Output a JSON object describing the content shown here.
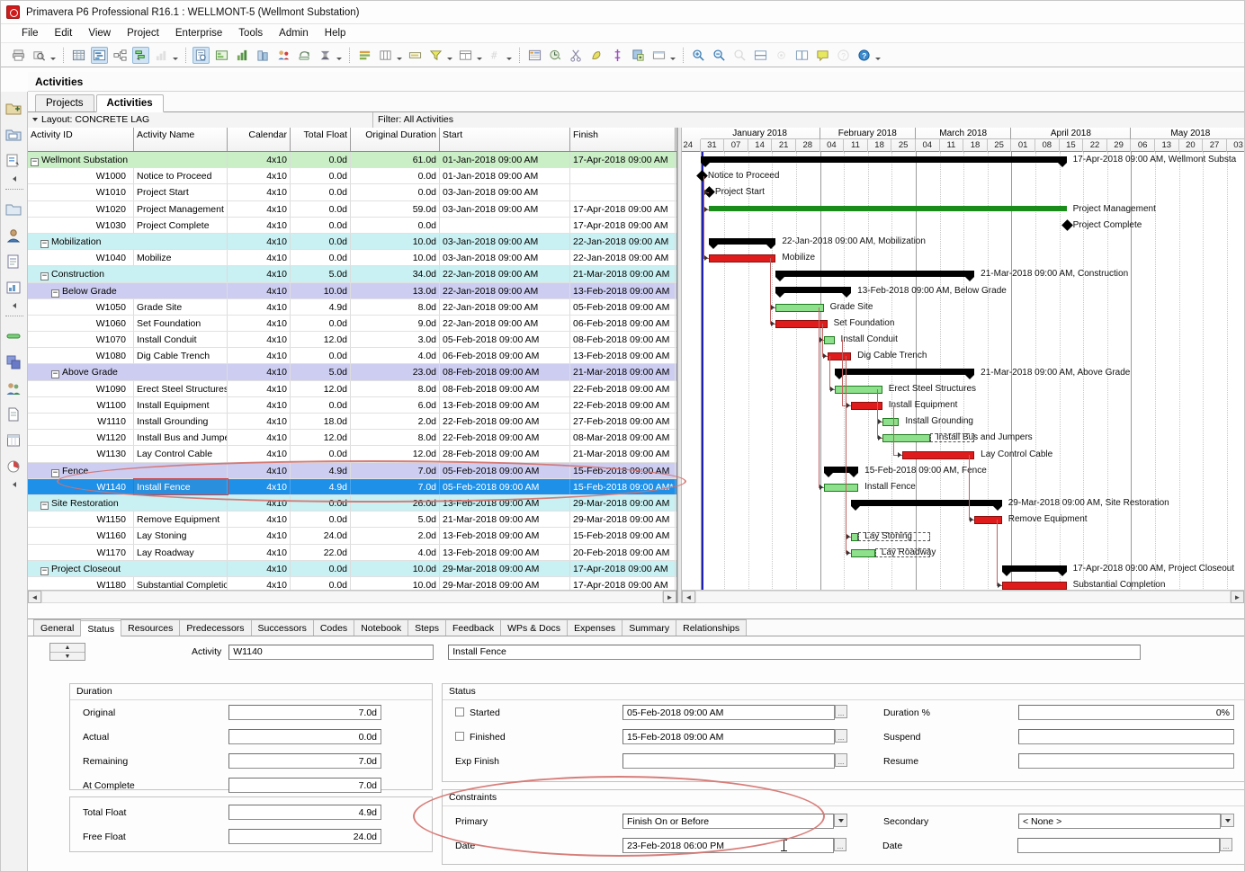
{
  "window": {
    "title": "Primavera P6 Professional R16.1 : WELLMONT-5 (Wellmont Substation)",
    "logo_color": "#cf1b1b"
  },
  "menu": [
    "File",
    "Edit",
    "View",
    "Project",
    "Enterprise",
    "Tools",
    "Admin",
    "Help"
  ],
  "workspace": {
    "title": "Activities",
    "tabs": [
      {
        "label": "Projects",
        "selected": false
      },
      {
        "label": "Activities",
        "selected": true
      }
    ]
  },
  "layout_bar": {
    "layout_label": "Layout: CONCRETE LAG",
    "filter_label": "Filter: All Activities"
  },
  "grid": {
    "columns": [
      "Activity ID",
      "Activity Name",
      "Calendar",
      "Total Float",
      "Original Duration",
      "Start",
      "Finish"
    ],
    "rows": [
      {
        "level": 0,
        "type": "wbs",
        "id": "Wellmont Substation",
        "name": "",
        "calendar": "4x10",
        "total_float": "0.0d",
        "original_duration": "61.0d",
        "start": "01-Jan-2018 09:00 AM",
        "finish": "17-Apr-2018 09:00 AM"
      },
      {
        "level": 0,
        "type": "task",
        "id": "W1000",
        "name": "Notice to Proceed",
        "calendar": "4x10",
        "total_float": "0.0d",
        "original_duration": "0.0d",
        "start": "01-Jan-2018 09:00 AM",
        "finish": ""
      },
      {
        "level": 0,
        "type": "task",
        "id": "W1010",
        "name": "Project Start",
        "calendar": "4x10",
        "total_float": "0.0d",
        "original_duration": "0.0d",
        "start": "03-Jan-2018 09:00 AM",
        "finish": ""
      },
      {
        "level": 0,
        "type": "task",
        "id": "W1020",
        "name": "Project Management",
        "calendar": "4x10",
        "total_float": "0.0d",
        "original_duration": "59.0d",
        "start": "03-Jan-2018 09:00 AM",
        "finish": "17-Apr-2018 09:00 AM"
      },
      {
        "level": 0,
        "type": "task",
        "id": "W1030",
        "name": "Project Complete",
        "calendar": "4x10",
        "total_float": "0.0d",
        "original_duration": "0.0d",
        "start": "",
        "finish": "17-Apr-2018 09:00 AM"
      },
      {
        "level": 1,
        "type": "wbs",
        "id": "Mobilization",
        "name": "",
        "calendar": "4x10",
        "total_float": "0.0d",
        "original_duration": "10.0d",
        "start": "03-Jan-2018 09:00 AM",
        "finish": "22-Jan-2018 09:00 AM"
      },
      {
        "level": 1,
        "type": "task",
        "id": "W1040",
        "name": "Mobilize",
        "calendar": "4x10",
        "total_float": "0.0d",
        "original_duration": "10.0d",
        "start": "03-Jan-2018 09:00 AM",
        "finish": "22-Jan-2018 09:00 AM"
      },
      {
        "level": 1,
        "type": "wbs",
        "id": "Construction",
        "name": "",
        "calendar": "4x10",
        "total_float": "5.0d",
        "original_duration": "34.0d",
        "start": "22-Jan-2018 09:00 AM",
        "finish": "21-Mar-2018 09:00 AM"
      },
      {
        "level": 2,
        "type": "wbs2",
        "id": "Below Grade",
        "name": "",
        "calendar": "4x10",
        "total_float": "10.0d",
        "original_duration": "13.0d",
        "start": "22-Jan-2018 09:00 AM",
        "finish": "13-Feb-2018 09:00 AM"
      },
      {
        "level": 2,
        "type": "task",
        "id": "W1050",
        "name": "Grade Site",
        "calendar": "4x10",
        "total_float": "4.9d",
        "original_duration": "8.0d",
        "start": "22-Jan-2018 09:00 AM",
        "finish": "05-Feb-2018 09:00 AM"
      },
      {
        "level": 2,
        "type": "task",
        "id": "W1060",
        "name": "Set Foundation",
        "calendar": "4x10",
        "total_float": "0.0d",
        "original_duration": "9.0d",
        "start": "22-Jan-2018 09:00 AM",
        "finish": "06-Feb-2018 09:00 AM"
      },
      {
        "level": 2,
        "type": "task",
        "id": "W1070",
        "name": "Install Conduit",
        "calendar": "4x10",
        "total_float": "12.0d",
        "original_duration": "3.0d",
        "start": "05-Feb-2018 09:00 AM",
        "finish": "08-Feb-2018 09:00 AM"
      },
      {
        "level": 2,
        "type": "task",
        "id": "W1080",
        "name": "Dig Cable Trench",
        "calendar": "4x10",
        "total_float": "0.0d",
        "original_duration": "4.0d",
        "start": "06-Feb-2018 09:00 AM",
        "finish": "13-Feb-2018 09:00 AM"
      },
      {
        "level": 2,
        "type": "wbs2",
        "id": "Above Grade",
        "name": "",
        "calendar": "4x10",
        "total_float": "5.0d",
        "original_duration": "23.0d",
        "start": "08-Feb-2018 09:00 AM",
        "finish": "21-Mar-2018 09:00 AM"
      },
      {
        "level": 2,
        "type": "task",
        "id": "W1090",
        "name": "Erect Steel Structures",
        "calendar": "4x10",
        "total_float": "12.0d",
        "original_duration": "8.0d",
        "start": "08-Feb-2018 09:00 AM",
        "finish": "22-Feb-2018 09:00 AM"
      },
      {
        "level": 2,
        "type": "task",
        "id": "W1100",
        "name": "Install Equipment",
        "calendar": "4x10",
        "total_float": "0.0d",
        "original_duration": "6.0d",
        "start": "13-Feb-2018 09:00 AM",
        "finish": "22-Feb-2018 09:00 AM"
      },
      {
        "level": 2,
        "type": "task",
        "id": "W1110",
        "name": "Install Grounding",
        "calendar": "4x10",
        "total_float": "18.0d",
        "original_duration": "2.0d",
        "start": "22-Feb-2018 09:00 AM",
        "finish": "27-Feb-2018 09:00 AM"
      },
      {
        "level": 2,
        "type": "task",
        "id": "W1120",
        "name": "Install Bus and Jumpers",
        "calendar": "4x10",
        "total_float": "12.0d",
        "original_duration": "8.0d",
        "start": "22-Feb-2018 09:00 AM",
        "finish": "08-Mar-2018 09:00 AM"
      },
      {
        "level": 2,
        "type": "task",
        "id": "W1130",
        "name": "Lay Control Cable",
        "calendar": "4x10",
        "total_float": "0.0d",
        "original_duration": "12.0d",
        "start": "28-Feb-2018 09:00 AM",
        "finish": "21-Mar-2018 09:00 AM"
      },
      {
        "level": 2,
        "type": "wbs2",
        "id": "Fence",
        "name": "",
        "calendar": "4x10",
        "total_float": "4.9d",
        "original_duration": "7.0d",
        "start": "05-Feb-2018 09:00 AM",
        "finish": "15-Feb-2018 09:00 AM"
      },
      {
        "level": 2,
        "type": "selected",
        "id": "W1140",
        "name": "Install Fence",
        "calendar": "4x10",
        "total_float": "4.9d",
        "original_duration": "7.0d",
        "start": "05-Feb-2018 09:00 AM",
        "finish": "15-Feb-2018 09:00 AM*"
      },
      {
        "level": 1,
        "type": "wbs",
        "id": "Site Restoration",
        "name": "",
        "calendar": "4x10",
        "total_float": "0.0d",
        "original_duration": "26.0d",
        "start": "13-Feb-2018 09:00 AM",
        "finish": "29-Mar-2018 09:00 AM"
      },
      {
        "level": 1,
        "type": "task",
        "id": "W1150",
        "name": "Remove Equipment",
        "calendar": "4x10",
        "total_float": "0.0d",
        "original_duration": "5.0d",
        "start": "21-Mar-2018 09:00 AM",
        "finish": "29-Mar-2018 09:00 AM"
      },
      {
        "level": 1,
        "type": "task",
        "id": "W1160",
        "name": "Lay Stoning",
        "calendar": "4x10",
        "total_float": "24.0d",
        "original_duration": "2.0d",
        "start": "13-Feb-2018 09:00 AM",
        "finish": "15-Feb-2018 09:00 AM"
      },
      {
        "level": 1,
        "type": "task",
        "id": "W1170",
        "name": "Lay Roadway",
        "calendar": "4x10",
        "total_float": "22.0d",
        "original_duration": "4.0d",
        "start": "13-Feb-2018 09:00 AM",
        "finish": "20-Feb-2018 09:00 AM"
      },
      {
        "level": 1,
        "type": "wbs",
        "id": "Project Closeout",
        "name": "",
        "calendar": "4x10",
        "total_float": "0.0d",
        "original_duration": "10.0d",
        "start": "29-Mar-2018 09:00 AM",
        "finish": "17-Apr-2018 09:00 AM"
      },
      {
        "level": 1,
        "type": "task",
        "id": "W1180",
        "name": "Substantial Completion",
        "calendar": "4x10",
        "total_float": "0.0d",
        "original_duration": "10.0d",
        "start": "29-Mar-2018 09:00 AM",
        "finish": "17-Apr-2018 09:00 AM"
      }
    ]
  },
  "gantt": {
    "months": [
      "January 2018",
      "February 2018",
      "March 2018",
      "April 2018",
      "May 2018"
    ],
    "weeks": [
      "24",
      "31",
      "07",
      "14",
      "21",
      "28",
      "04",
      "11",
      "18",
      "25",
      "04",
      "11",
      "18",
      "25",
      "01",
      "08",
      "15",
      "22",
      "29",
      "06",
      "13",
      "20",
      "27",
      "03"
    ],
    "bar_labels": [
      "17-Apr-2018 09:00 AM, Wellmont Substa",
      "Notice to Proceed",
      "Project Start",
      "Project Management",
      "Project Complete",
      "22-Jan-2018 09:00 AM, Mobilization",
      "Mobilize",
      "21-Mar-2018 09:00 AM, Construction",
      "13-Feb-2018 09:00 AM, Below Grade",
      "Grade Site",
      "Set Foundation",
      "Install Conduit",
      "Dig Cable Trench",
      "21-Mar-2018 09:00 AM, Above Grade",
      "Erect Steel Structures",
      "Install Equipment",
      "Install Grounding",
      "Install Bus and Jumpers",
      "Lay Control Cable",
      "15-Feb-2018 09:00 AM, Fence",
      "Install Fence",
      "29-Mar-2018 09:00 AM, Site Restoration",
      "Remove Equipment",
      "Lay Stoning",
      "Lay Roadway",
      "17-Apr-2018 09:00 AM, Project Closeout",
      "Substantial Completion"
    ]
  },
  "detail": {
    "tabs": [
      {
        "label": "General",
        "selected": false
      },
      {
        "label": "Status",
        "selected": true
      },
      {
        "label": "Resources",
        "selected": false
      },
      {
        "label": "Predecessors",
        "selected": false
      },
      {
        "label": "Successors",
        "selected": false
      },
      {
        "label": "Codes",
        "selected": false
      },
      {
        "label": "Notebook",
        "selected": false
      },
      {
        "label": "Steps",
        "selected": false
      },
      {
        "label": "Feedback",
        "selected": false
      },
      {
        "label": "WPs & Docs",
        "selected": false
      },
      {
        "label": "Expenses",
        "selected": false
      },
      {
        "label": "Summary",
        "selected": false
      },
      {
        "label": "Relationships",
        "selected": false
      }
    ],
    "activity_label": "Activity",
    "activity_id": "W1140",
    "activity_name": "Install Fence",
    "duration": {
      "caption": "Duration",
      "original_label": "Original",
      "original_value": "7.0d",
      "actual_label": "Actual",
      "actual_value": "0.0d",
      "remaining_label": "Remaining",
      "remaining_value": "7.0d",
      "at_complete_label": "At Complete",
      "at_complete_value": "7.0d"
    },
    "float": {
      "total_float_label": "Total Float",
      "total_float_value": "4.9d",
      "free_float_label": "Free Float",
      "free_float_value": "24.0d"
    },
    "status": {
      "caption": "Status",
      "started_label": "Started",
      "started_value": "05-Feb-2018 09:00 AM",
      "started_checked": false,
      "finished_label": "Finished",
      "finished_value": "15-Feb-2018 09:00 AM",
      "finished_checked": false,
      "exp_finish_label": "Exp Finish",
      "exp_finish_value": "",
      "duration_pct_label": "Duration %",
      "duration_pct_value": "0%",
      "suspend_label": "Suspend",
      "suspend_value": "",
      "resume_label": "Resume",
      "resume_value": ""
    },
    "constraints": {
      "caption": "Constraints",
      "primary_label": "Primary",
      "primary_value": "Finish On or Before",
      "primary_date_label": "Date",
      "primary_date_value": "23-Feb-2018 06:00 PM",
      "secondary_label": "Secondary",
      "secondary_value": "< None >",
      "secondary_date_label": "Date",
      "secondary_date_value": ""
    }
  },
  "colors": {
    "wbs_level0": "#caeec6",
    "wbs_level1": "#c9f0f2",
    "wbs_level2": "#cdcdf2",
    "selected_row": "#1e90e8",
    "critical_bar": "#e01b1b",
    "noncritical_bar": "#8ee08c",
    "summary_bar": "#000000",
    "annotation": "#d4736f"
  }
}
